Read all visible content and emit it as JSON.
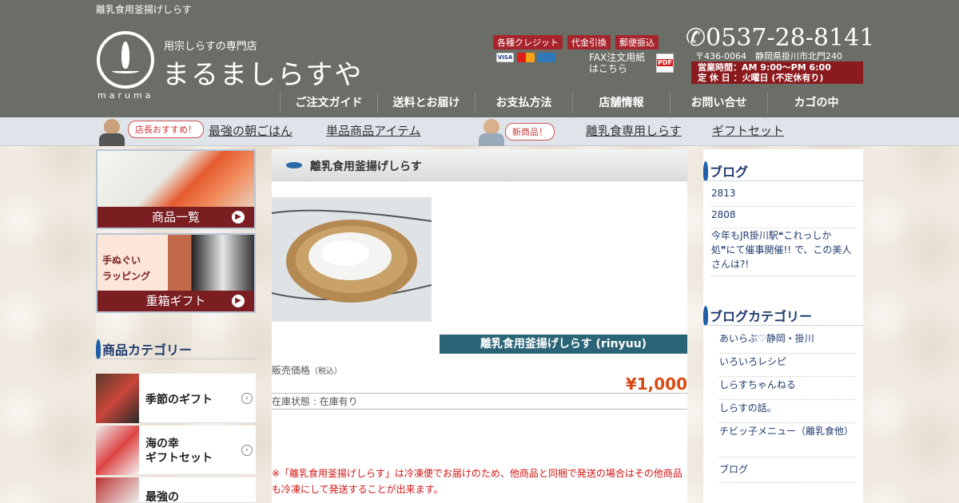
{
  "colors": {
    "header_bg": "#6b6e66",
    "subnav_bg": "#dfe4ea",
    "accent_red": "#a8242c",
    "price_orange": "#d84a14",
    "notice_red": "#d21414",
    "title_bar_teal": "#2a6476",
    "heading_blue": "#1e3b6e"
  },
  "header": {
    "tagline": "離乳食用釜揚げしらす",
    "logo": {
      "icon": "shirasu-drop-logo-icon",
      "romaji": "maruma",
      "sub": "用宗しらすの専門店",
      "name": "まるましらすや"
    },
    "payment_badges": [
      "各種クレジット",
      "代金引換",
      "郵便振込"
    ],
    "card_icons": [
      "visa-icon",
      "mastercard-icon",
      "amex-icon"
    ],
    "fax": {
      "label_line1": "FAX注文用紙",
      "label_line2": "はこちら",
      "icon": "pdf-icon",
      "icon_text": "PDF"
    },
    "phone": "0537-28-8141",
    "phone_icon": "phone-handset-icon",
    "address": "〒436-0064　静岡県掛川市北門240",
    "hours_line1": "営業時間：AM 9:00〜PM 6:00",
    "hours_line2": "定 休 日 ：火曜日 (不定休有り)",
    "nav": [
      "ご注文ガイド",
      "送料とお届け",
      "お支払方法",
      "店舗情報",
      "お問い合せ",
      "カゴの中"
    ]
  },
  "subnav": {
    "bubble_left": "店長おすすめ！",
    "bubble_right": "新商品！",
    "items": [
      "最強の朝ごはん",
      "単品商品アイテム",
      "離乳食専用しらす",
      "ギフトセット"
    ]
  },
  "left": {
    "banners": [
      {
        "label": "商品一覧"
      },
      {
        "label": "重箱ギフト",
        "overlay_line1": "手ぬぐい",
        "overlay_line2": "ラッピング"
      }
    ],
    "category_title": "商品カテゴリー",
    "categories": [
      {
        "label_line1": "季節のギフト",
        "label_line2": ""
      },
      {
        "label_line1": "海の幸",
        "label_line2": "ギフトセット"
      },
      {
        "label_line1": "最強の",
        "label_line2": ""
      }
    ]
  },
  "product": {
    "page_title": "離乳食用釜揚げしらす",
    "name": "離乳食用釜揚げしらす (rinyuu)",
    "price_label": "販売価格",
    "tax_note": "（税込）",
    "price": "¥1,000",
    "stock": "在庫状態 : 在庫有り",
    "notice": "※「離乳食用釜揚げしらす」は冷凍便でお届けのため、他商品と同梱で発送の場合はその他商品も冷凍にして発送することが出来ます。"
  },
  "right": {
    "blog_title": "ブログ",
    "blog_items": [
      "2813",
      "2808",
      "今年もJR掛川駅❝これっしか処❞にて催事開催!! で、この美人さんは?!"
    ],
    "blog_cat_title": "ブログカテゴリー",
    "blog_categories": [
      "あいらぶ♡静岡・掛川",
      "いろいろレシピ",
      "しらすちゃんねる",
      "しらすの話。",
      "チビッ子メニュー（離乳食他）",
      "ブログ"
    ]
  }
}
